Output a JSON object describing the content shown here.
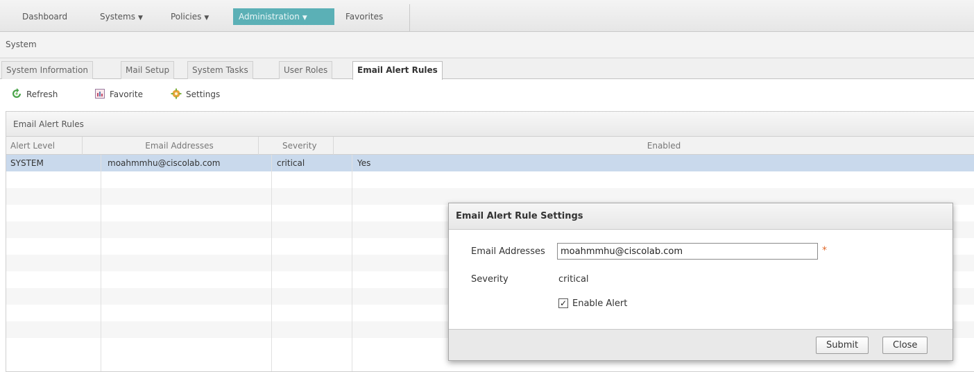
{
  "nav": {
    "items": [
      {
        "label": "Dashboard"
      },
      {
        "label": "Systems",
        "arrow": "▼"
      },
      {
        "label": "Policies",
        "arrow": "▼"
      },
      {
        "label": "Administration",
        "arrow": "▼"
      },
      {
        "label": "Favorites"
      }
    ],
    "active_color": "#5bb0b6"
  },
  "system": {
    "title": "System"
  },
  "tabs": [
    {
      "label": "System Information"
    },
    {
      "label": "Mail Setup"
    },
    {
      "label": "System Tasks"
    },
    {
      "label": "User Roles"
    },
    {
      "label": "Email Alert Rules",
      "active": true
    }
  ],
  "toolbar": {
    "refresh_label": "Refresh",
    "favorite_label": "Favorite",
    "settings_label": "Settings"
  },
  "panel": {
    "title": "Email Alert Rules"
  },
  "grid": {
    "columns": [
      "Alert Level",
      "Email Addresses",
      "Severity",
      "Enabled"
    ],
    "rows": [
      {
        "alert_level": "SYSTEM",
        "email": "moahmmhu@ciscolab.com",
        "severity": "critical",
        "enabled": "Yes",
        "selected": true
      }
    ],
    "selected_color": "#c9d9ec"
  },
  "dialog": {
    "title": "Email Alert Rule Settings",
    "email_label": "Email Addresses",
    "email_value": "moahmmhu@ciscolab.com",
    "required_mark": "*",
    "severity_label": "Severity",
    "severity_value": "critical",
    "enable_label": "Enable Alert",
    "enable_checked": true,
    "check_glyph": "✓",
    "submit_label": "Submit",
    "close_label": "Close"
  }
}
